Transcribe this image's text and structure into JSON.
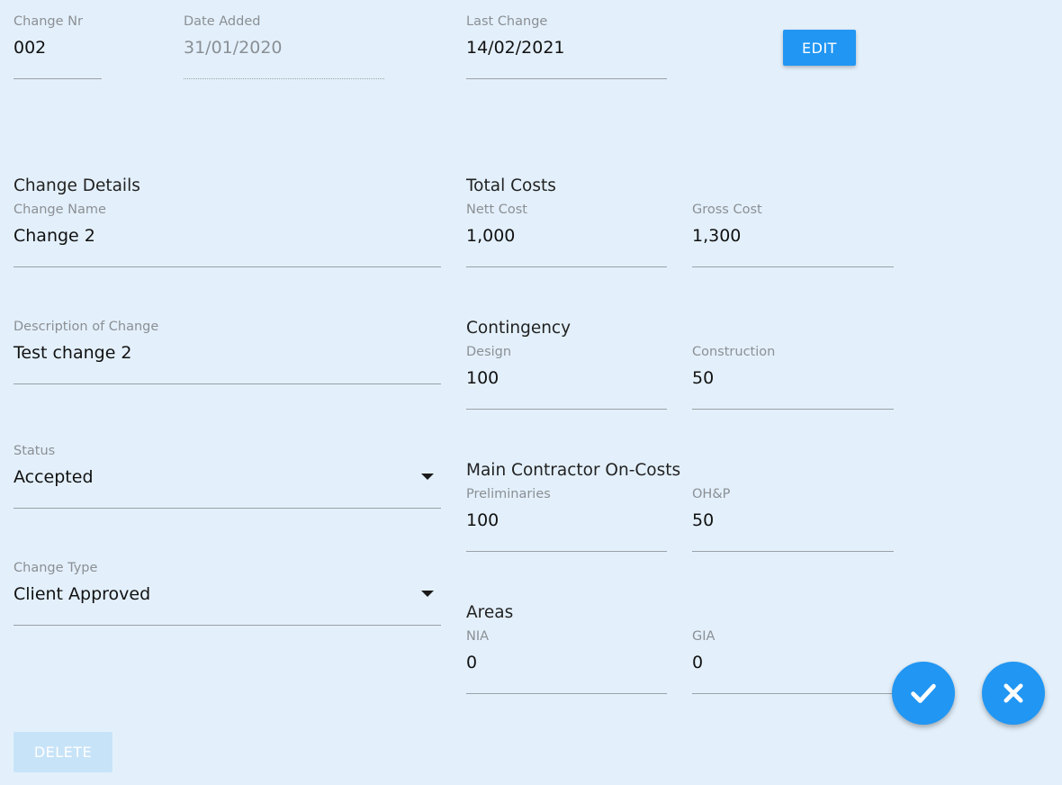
{
  "header": {
    "change_nr": {
      "label": "Change Nr",
      "value": "002"
    },
    "date_added": {
      "label": "Date Added",
      "value": "31/01/2020"
    },
    "last_change": {
      "label": "Last Change",
      "value": "14/02/2021"
    },
    "edit_label": "EDIT"
  },
  "details": {
    "title": "Change Details",
    "change_name": {
      "label": "Change Name",
      "value": "Change 2"
    },
    "description": {
      "label": "Description of Change",
      "value": "Test change 2"
    },
    "status": {
      "label": "Status",
      "value": "Accepted"
    },
    "change_type": {
      "label": "Change Type",
      "value": "Client Approved"
    }
  },
  "total_costs": {
    "title": "Total Costs",
    "nett": {
      "label": "Nett Cost",
      "value": "1,000"
    },
    "gross": {
      "label": "Gross Cost",
      "value": "1,300"
    }
  },
  "contingency": {
    "title": "Contingency",
    "design": {
      "label": "Design",
      "value": "100"
    },
    "construction": {
      "label": "Construction",
      "value": "50"
    }
  },
  "oncosts": {
    "title": "Main Contractor On-Costs",
    "preliminaries": {
      "label": "Preliminaries",
      "value": "100"
    },
    "ohp": {
      "label": "OH&P",
      "value": "50"
    }
  },
  "areas": {
    "title": "Areas",
    "nia": {
      "label": "NIA",
      "value": "0"
    },
    "gia": {
      "label": "GIA",
      "value": "0"
    }
  },
  "actions": {
    "delete_label": "DELETE",
    "confirm_icon": "check-icon",
    "cancel_icon": "close-icon"
  },
  "colors": {
    "background": "#e3f0fb",
    "accent": "#2196f3",
    "disabled_button": "#c7e3f8"
  }
}
